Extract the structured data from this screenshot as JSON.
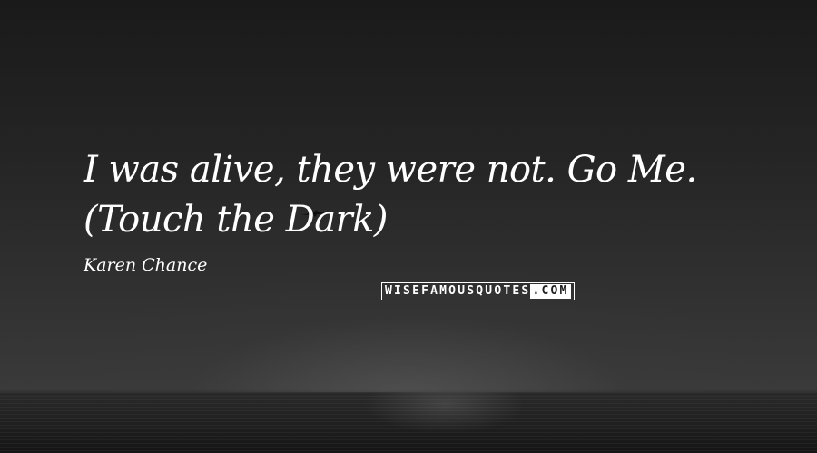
{
  "quote": {
    "text": "I was alive, they were not. Go Me. (Touch the Dark)"
  },
  "author": {
    "name": "Karen Chance"
  },
  "watermark": {
    "part_a": "WISEFAMOUSQUOTES",
    "part_b": ".COM"
  },
  "icons": {
    "bird": "bird-icon"
  },
  "colors": {
    "text": "#ffffff",
    "background": "#1f1f1f"
  }
}
